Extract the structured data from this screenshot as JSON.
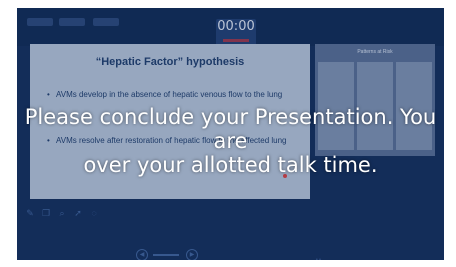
{
  "timer": {
    "value": "00:00"
  },
  "slide": {
    "title": "“Hepatic Factor” hypothesis",
    "bullets": [
      "AVMs develop in the absence of hepatic venous flow to the lung",
      "AVMs resolve after restoration of hepatic flow to the affected lung"
    ]
  },
  "next_slide": {
    "title": "Patterns at Risk"
  },
  "warning": {
    "line1": "Please conclude your Presentation. You are",
    "line2": "over your allotted talk time."
  },
  "colors": {
    "background": "#122c57",
    "slide": "#bcc8d9",
    "warning_text": "#ffffff",
    "timer_accent": "#c0333d"
  },
  "icons": [
    "pen-icon",
    "copy-icon",
    "zoom-icon",
    "pointer-icon",
    "more-icon",
    "prev-arrow-icon",
    "next-arrow-icon"
  ]
}
